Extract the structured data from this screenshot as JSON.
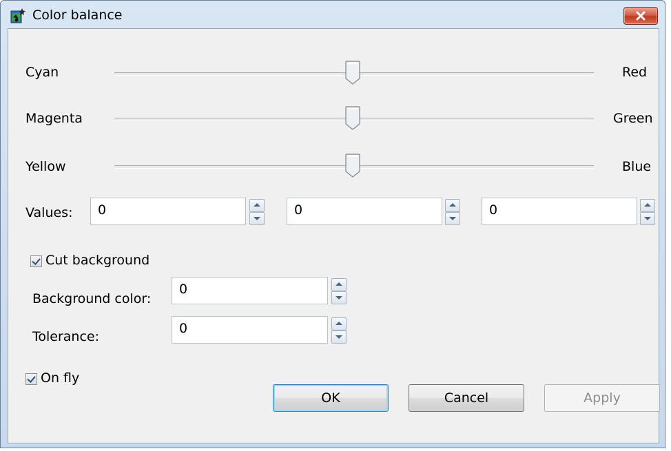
{
  "window": {
    "title": "Color balance",
    "app_icon": "color-balance-app-icon",
    "close_icon": "close-icon"
  },
  "sliders": [
    {
      "left_label": "Cyan",
      "right_label": "Red",
      "value": 0,
      "range": [
        -100,
        100
      ]
    },
    {
      "left_label": "Magenta",
      "right_label": "Green",
      "value": 0,
      "range": [
        -100,
        100
      ]
    },
    {
      "left_label": "Yellow",
      "right_label": "Blue",
      "value": 0,
      "range": [
        -100,
        100
      ]
    }
  ],
  "values": {
    "label": "Values:",
    "fields": [
      "0",
      "0",
      "0"
    ]
  },
  "cut_background": {
    "label": "Cut background",
    "checked": true
  },
  "background_color": {
    "label": "Background color:",
    "value": "0"
  },
  "tolerance": {
    "label": "Tolerance:",
    "value": "0"
  },
  "on_fly": {
    "label": "On fly",
    "checked": true
  },
  "buttons": {
    "ok": "OK",
    "cancel": "Cancel",
    "apply": "Apply"
  },
  "colors": {
    "close_button": "#c0391f",
    "checkmark": "#2a4f86",
    "default_button_glow": "#96d9f9"
  }
}
